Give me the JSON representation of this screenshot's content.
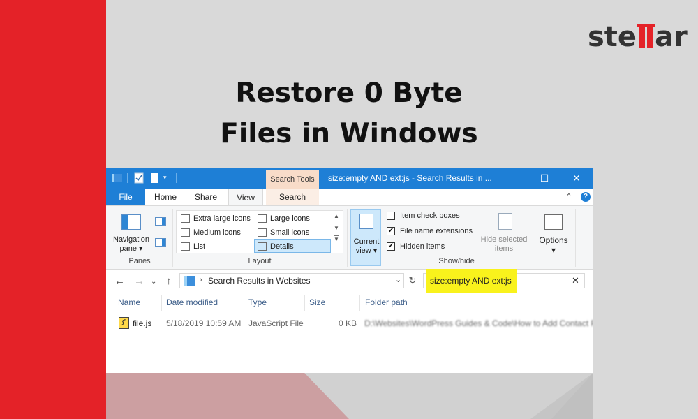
{
  "brand": {
    "logo_text_left": "ste",
    "logo_text_right": "ar",
    "red": "#e42228"
  },
  "headline": {
    "line1": "Restore 0 Byte",
    "line2": "Files in Windows"
  },
  "window": {
    "contextual_tab_title": "Search Tools",
    "title": "size:empty AND ext:js - Search Results in ...",
    "controls": {
      "minimize": "—",
      "maximize": "☐",
      "close": "✕"
    },
    "accent": "#1e7fd6"
  },
  "tabs": {
    "file": "File",
    "home": "Home",
    "share": "Share",
    "view": "View",
    "search": "Search",
    "collapse": "⌃",
    "help": "?"
  },
  "ribbon": {
    "panes": {
      "navigation_pane_line1": "Navigation",
      "navigation_pane_line2": "pane ▾",
      "group": "Panes"
    },
    "layout": {
      "items": [
        "Extra large icons",
        "Large icons",
        "Medium icons",
        "Small icons",
        "List",
        "Details"
      ],
      "selected": "Details",
      "group": "Layout"
    },
    "current_view": {
      "line1": "Current",
      "line2": "view ▾"
    },
    "show_hide": {
      "item_check_boxes": {
        "label": "Item check boxes",
        "checked": false
      },
      "file_name_extensions": {
        "label": "File name extensions",
        "checked": true
      },
      "hidden_items": {
        "label": "Hidden items",
        "checked": true
      },
      "hide_selected_line1": "Hide selected",
      "hide_selected_line2": "items",
      "group": "Show/hide"
    },
    "options": {
      "line1": "Options",
      "line2": "▾"
    }
  },
  "address": {
    "path_text": "Search Results in Websites",
    "search_query": "size:empty AND ext:js",
    "highlight_color": "#f9f21c"
  },
  "columns": [
    "Name",
    "Date modified",
    "Type",
    "Size",
    "Folder path"
  ],
  "files": [
    {
      "name": "file.js",
      "date_modified": "5/18/2019 10:59 AM",
      "type": "JavaScript File",
      "size": "0 KB",
      "folder_path": "D:\\Websites\\WordPress Guides & Code\\How to Add Contact F"
    }
  ]
}
